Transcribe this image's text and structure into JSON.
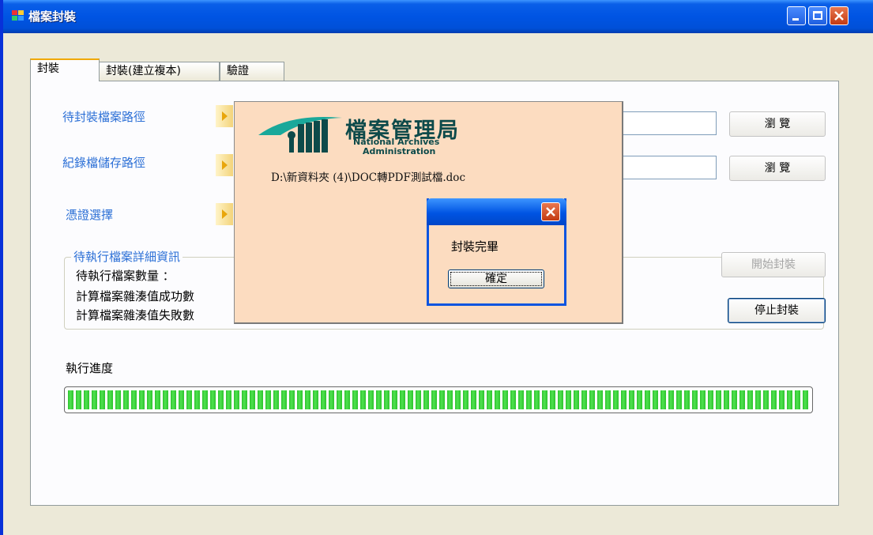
{
  "window": {
    "title": "檔案封裝"
  },
  "tabs": [
    {
      "label": "封裝"
    },
    {
      "label": "封裝(建立複本)"
    },
    {
      "label": "驗證"
    }
  ],
  "form": {
    "source_path_label": "待封裝檔案路徑",
    "record_path_label": "紀錄檔儲存路徑",
    "cert_label": "憑證選擇",
    "browse_label": "瀏 覽"
  },
  "details": {
    "group_title": "待執行檔案詳細資訊",
    "pending_count_label": "待執行檔案數量 ：",
    "hash_success_label": "計算檔案雜湊值成功數",
    "hash_fail_label": "計算檔案雜湊值失敗數"
  },
  "actions": {
    "start_label": "開始封裝",
    "stop_label": "停止封裝"
  },
  "progress": {
    "label": "執行進度",
    "value": 100
  },
  "splash": {
    "logo_zh": "檔案管理局",
    "logo_en_line1": "National Archives",
    "logo_en_line2": "Administration",
    "file_path": "D:\\新資料夾 (4)\\DOC轉PDF測試檔.doc"
  },
  "message": {
    "text": "封裝完畢",
    "ok_label": "確定"
  },
  "colors": {
    "accent_blue": "#2b6fd6",
    "progress_green": "#2ec32e",
    "splash_bg": "#fcdcc0"
  }
}
